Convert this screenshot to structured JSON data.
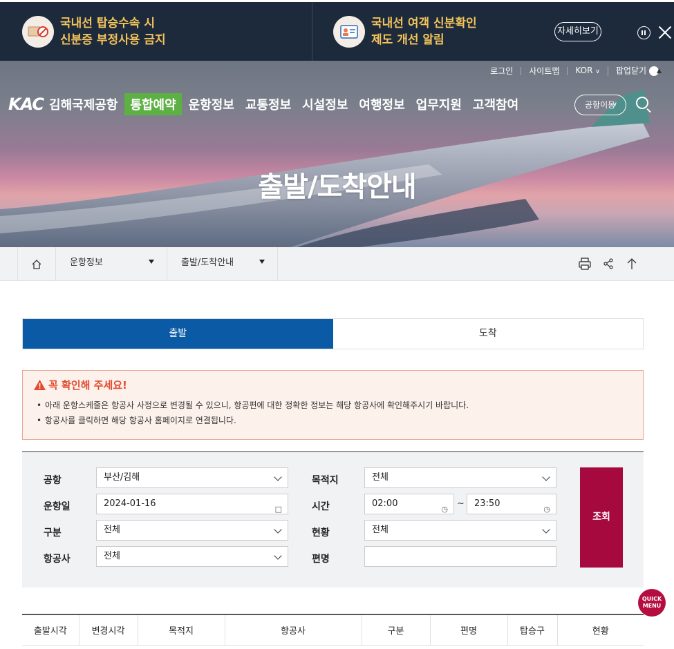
{
  "popup": {
    "item1_line1": "국내선 탑승수속 시",
    "item1_line2": "신분증 부정사용 금지",
    "item2_line1": "국내선 여객 신분확인",
    "item2_line2": "제도 개선 알림",
    "more_label": "자세히보기"
  },
  "utility": {
    "login": "로그인",
    "sitemap": "사이트맵",
    "language": "KOR",
    "popup_close": "팝업닫기"
  },
  "header": {
    "logo": "KAC",
    "airport_name": "김해국제공항",
    "menu": [
      "통합예약",
      "운항정보",
      "교통정보",
      "시설정보",
      "여행정보",
      "업무지원",
      "고객참여"
    ],
    "airport_move": "공항이동"
  },
  "page_title": "출발/도착안내",
  "breadcrumb": {
    "level1": "운항정보",
    "level2": "출발/도착안내"
  },
  "tabs": {
    "departure": "출발",
    "arrival": "도착"
  },
  "notice": {
    "title": "꼭 확인해 주세요!",
    "items": [
      "아래 운항스케줄은 항공사 사정으로 변경될 수 있으니, 항공편에 대한 정확한 정보는 해당 항공사에 확인해주시기 바랍니다.",
      "항공사를 클릭하면 해당 항공사 홈페이지로 연결됩니다."
    ]
  },
  "search": {
    "airport_label": "공항",
    "airport_value": "부산/김해",
    "date_label": "운항일",
    "date_value": "2024-01-16",
    "type_label": "구분",
    "type_value": "전체",
    "airline_label": "항공사",
    "airline_value": "전체",
    "destination_label": "목적지",
    "destination_value": "전체",
    "time_label": "시간",
    "time_from": "02:00",
    "time_to": "23:50",
    "time_sep": "~",
    "status_label": "현황",
    "status_value": "전체",
    "flight_label": "편명",
    "flight_value": "",
    "submit": "조회"
  },
  "quick_menu": {
    "line1": "QUICK",
    "line2": "MENU"
  },
  "table": {
    "headers": [
      "출발시각",
      "변경시각",
      "목적지",
      "항공사",
      "구분",
      "편명",
      "탑승구",
      "현황"
    ]
  },
  "colors": {
    "popup_bg": "#1d2a3c",
    "popup_text": "#f3c35a",
    "active_menu": "#5db043",
    "tab_active": "#0b5aa5",
    "search_button": "#a6093d",
    "notice_title": "#e34b2f"
  }
}
